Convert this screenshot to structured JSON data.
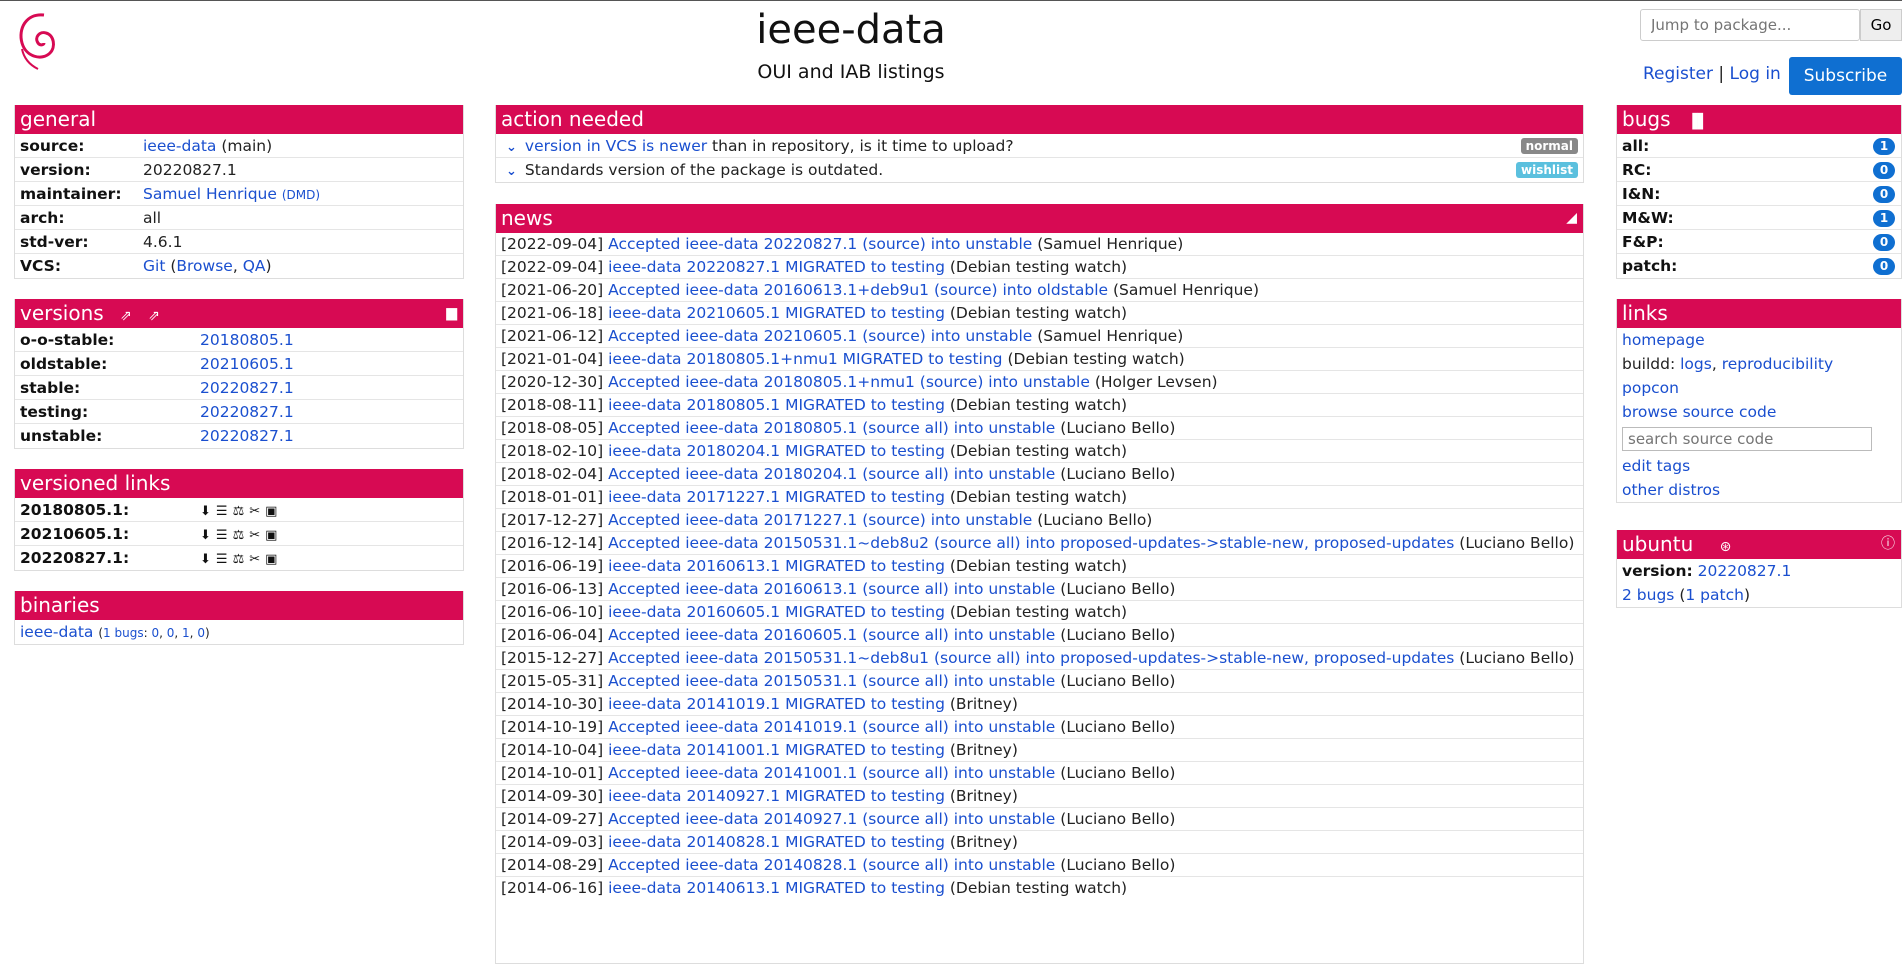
{
  "header": {
    "title": "ieee-data",
    "subtitle": "OUI and IAB listings",
    "jump_placeholder": "Jump to package...",
    "go_label": "Go",
    "register_label": "Register",
    "separator": "|",
    "login_label": "Log in",
    "subscribe_label": "Subscribe"
  },
  "general": {
    "title": "general",
    "source_key": "source:",
    "source_link": "ieee-data",
    "source_suffix": " (main)",
    "version_key": "version:",
    "version_val": "20220827.1",
    "maintainer_key": "maintainer:",
    "maintainer_link": "Samuel Henrique",
    "maintainer_dmd": "(DMD)",
    "arch_key": "arch:",
    "arch_val": "all",
    "stdver_key": "std-ver:",
    "stdver_val": "4.6.1",
    "vcs_key": "VCS:",
    "vcs_git": "Git",
    "vcs_browse": "Browse",
    "vcs_qa": "QA"
  },
  "versions": {
    "title": "versions",
    "rows": [
      {
        "k": "o-o-stable:",
        "v": "20180805.1"
      },
      {
        "k": "oldstable:",
        "v": "20210605.1"
      },
      {
        "k": "stable:",
        "v": "20220827.1"
      },
      {
        "k": "testing:",
        "v": "20220827.1"
      },
      {
        "k": "unstable:",
        "v": "20220827.1"
      }
    ]
  },
  "versioned_links": {
    "title": "versioned links",
    "rows": [
      "20180805.1:",
      "20210605.1:",
      "20220827.1:"
    ]
  },
  "binaries": {
    "title": "binaries",
    "name": "ieee-data",
    "open": "(",
    "bugs_label": "1 bugs",
    "colon": ":",
    "c1": "0",
    "c2": "0",
    "c3": "1",
    "c4": "0",
    "close": ")"
  },
  "action_needed": {
    "title": "action needed",
    "item1_link": "version in VCS is newer",
    "item1_text": " than in repository, is it time to upload?",
    "item1_badge": "normal",
    "item2_text": "Standards version of the package is outdated.",
    "item2_badge": "wishlist"
  },
  "news": {
    "title": "news",
    "items": [
      {
        "date": "[2022-09-04]",
        "link": "Accepted ieee-data 20220827.1 (source) into unstable",
        "who": "(Samuel Henrique)"
      },
      {
        "date": "[2022-09-04]",
        "link": "ieee-data 20220827.1 MIGRATED to testing",
        "who": "(Debian testing watch)"
      },
      {
        "date": "[2021-06-20]",
        "link": "Accepted ieee-data 20160613.1+deb9u1 (source) into oldstable",
        "who": "(Samuel Henrique)"
      },
      {
        "date": "[2021-06-18]",
        "link": "ieee-data 20210605.1 MIGRATED to testing",
        "who": "(Debian testing watch)"
      },
      {
        "date": "[2021-06-12]",
        "link": "Accepted ieee-data 20210605.1 (source) into unstable",
        "who": "(Samuel Henrique)"
      },
      {
        "date": "[2021-01-04]",
        "link": "ieee-data 20180805.1+nmu1 MIGRATED to testing",
        "who": "(Debian testing watch)"
      },
      {
        "date": "[2020-12-30]",
        "link": "Accepted ieee-data 20180805.1+nmu1 (source) into unstable",
        "who": "(Holger Levsen)"
      },
      {
        "date": "[2018-08-11]",
        "link": "ieee-data 20180805.1 MIGRATED to testing",
        "who": "(Debian testing watch)"
      },
      {
        "date": "[2018-08-05]",
        "link": "Accepted ieee-data 20180805.1 (source all) into unstable",
        "who": "(Luciano Bello)"
      },
      {
        "date": "[2018-02-10]",
        "link": "ieee-data 20180204.1 MIGRATED to testing",
        "who": "(Debian testing watch)"
      },
      {
        "date": "[2018-02-04]",
        "link": "Accepted ieee-data 20180204.1 (source all) into unstable",
        "who": "(Luciano Bello)"
      },
      {
        "date": "[2018-01-01]",
        "link": "ieee-data 20171227.1 MIGRATED to testing",
        "who": "(Debian testing watch)"
      },
      {
        "date": "[2017-12-27]",
        "link": "Accepted ieee-data 20171227.1 (source) into unstable",
        "who": "(Luciano Bello)"
      },
      {
        "date": "[2016-12-14]",
        "link": "Accepted ieee-data 20150531.1~deb8u2 (source all) into proposed-updates->stable-new, proposed-updates",
        "who": "(Luciano Bello)"
      },
      {
        "date": "[2016-06-19]",
        "link": "ieee-data 20160613.1 MIGRATED to testing",
        "who": "(Debian testing watch)"
      },
      {
        "date": "[2016-06-13]",
        "link": "Accepted ieee-data 20160613.1 (source all) into unstable",
        "who": "(Luciano Bello)"
      },
      {
        "date": "[2016-06-10]",
        "link": "ieee-data 20160605.1 MIGRATED to testing",
        "who": "(Debian testing watch)"
      },
      {
        "date": "[2016-06-04]",
        "link": "Accepted ieee-data 20160605.1 (source all) into unstable",
        "who": "(Luciano Bello)"
      },
      {
        "date": "[2015-12-27]",
        "link": "Accepted ieee-data 20150531.1~deb8u1 (source all) into proposed-updates->stable-new, proposed-updates",
        "who": "(Luciano Bello)"
      },
      {
        "date": "[2015-05-31]",
        "link": "Accepted ieee-data 20150531.1 (source all) into unstable",
        "who": "(Luciano Bello)"
      },
      {
        "date": "[2014-10-30]",
        "link": "ieee-data 20141019.1 MIGRATED to testing",
        "who": "(Britney)"
      },
      {
        "date": "[2014-10-19]",
        "link": "Accepted ieee-data 20141019.1 (source all) into unstable",
        "who": "(Luciano Bello)"
      },
      {
        "date": "[2014-10-04]",
        "link": "ieee-data 20141001.1 MIGRATED to testing",
        "who": "(Britney)"
      },
      {
        "date": "[2014-10-01]",
        "link": "Accepted ieee-data 20141001.1 (source all) into unstable",
        "who": "(Luciano Bello)"
      },
      {
        "date": "[2014-09-30]",
        "link": "ieee-data 20140927.1 MIGRATED to testing",
        "who": "(Britney)"
      },
      {
        "date": "[2014-09-27]",
        "link": "Accepted ieee-data 20140927.1 (source all) into unstable",
        "who": "(Luciano Bello)"
      },
      {
        "date": "[2014-09-03]",
        "link": "ieee-data 20140828.1 MIGRATED to testing",
        "who": "(Britney)"
      },
      {
        "date": "[2014-08-29]",
        "link": "Accepted ieee-data 20140828.1 (source all) into unstable",
        "who": "(Luciano Bello)"
      },
      {
        "date": "[2014-06-16]",
        "link": "ieee-data 20140613.1 MIGRATED to testing",
        "who": "(Debian testing watch)"
      }
    ]
  },
  "bugs": {
    "title": "bugs",
    "rows": [
      {
        "k": "all:",
        "v": "1"
      },
      {
        "k": "RC:",
        "v": "0"
      },
      {
        "k": "I&N:",
        "v": "0"
      },
      {
        "k": "M&W:",
        "v": "1"
      },
      {
        "k": "F&P:",
        "v": "0"
      },
      {
        "k": "patch:",
        "v": "0"
      }
    ]
  },
  "links": {
    "title": "links",
    "homepage": "homepage",
    "buildd_label": "buildd:",
    "buildd_logs": "logs",
    "comma": ",",
    "buildd_repro": "reproducibility",
    "popcon": "popcon",
    "browse_source": "browse source code",
    "search_placeholder": "search source code",
    "edit_tags": "edit tags",
    "other_distros": "other distros"
  },
  "ubuntu": {
    "title": "ubuntu",
    "version_key": "version:",
    "version_val": "20220827.1",
    "bugs_link": "2 bugs",
    "patch_link": "1 patch",
    "open": "(",
    "close": ")"
  }
}
